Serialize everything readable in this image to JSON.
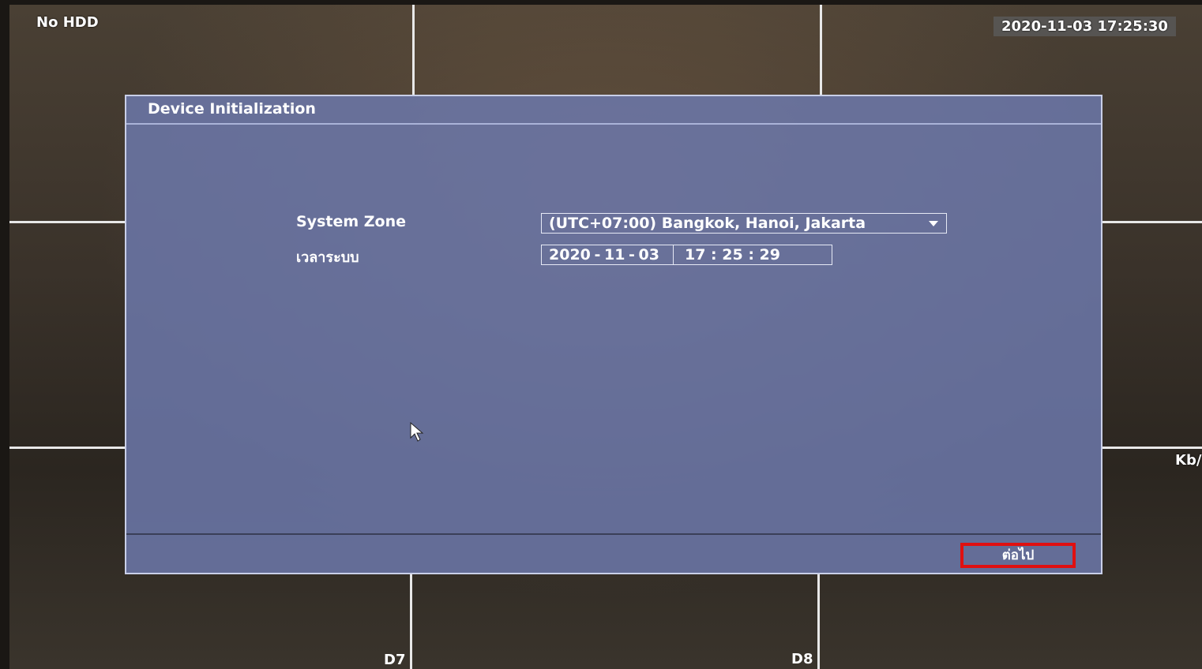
{
  "osd": {
    "hdd_status": "No HDD",
    "datetime": "2020-11-03 17:25:30",
    "right_edge_kb": "Kb/"
  },
  "cameras": {
    "bottom_left_label": "D7",
    "bottom_right_label": "D8"
  },
  "dialog": {
    "title": "Device Initialization",
    "system_zone_label": "System Zone",
    "system_zone_value": "(UTC+07:00) Bangkok, Hanoi, Jakarta",
    "system_time_label": "เวลาระบบ",
    "date_value": "2020 - 11 - 03",
    "time_value": "17 : 25 : 29",
    "next_label": "ต่อไป"
  },
  "colors": {
    "dialog_bg": "#6c78aa",
    "highlight_border": "#e01010"
  }
}
